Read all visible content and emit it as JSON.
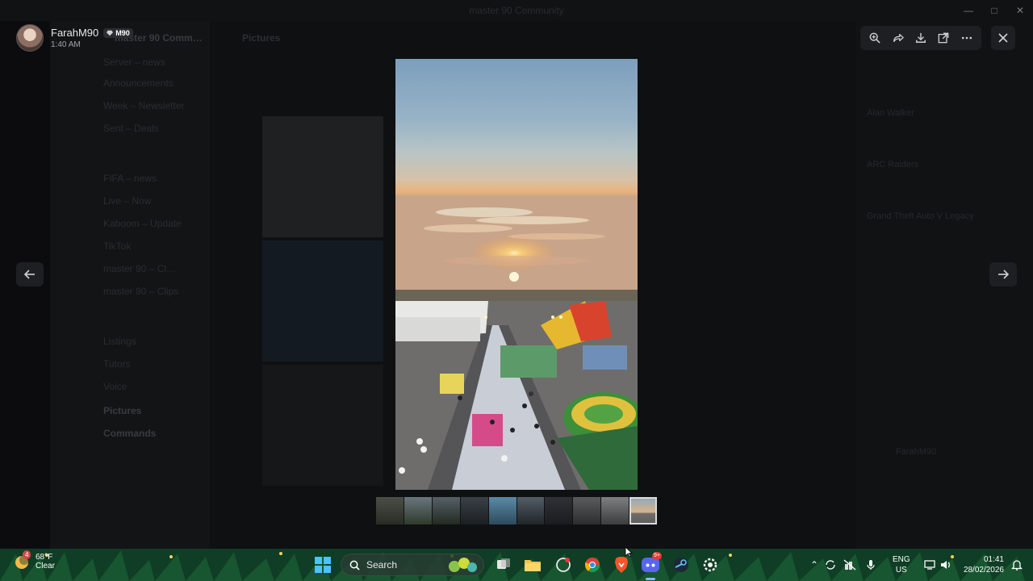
{
  "window": {
    "title": "master 90 Community"
  },
  "background": {
    "server_name": "master 90 Comm…",
    "channel_header": "Pictures",
    "channels": [
      "Server – news",
      "Announcements",
      "Week – Newsletter",
      "Sent – Deals",
      "FIFA – news",
      "Live – Now",
      "Kaboom – Update",
      "TikTok",
      "master 90 – Cl…",
      "master 90 – Clips",
      "Listings",
      "Tutors",
      "Voice",
      "Pictures",
      "Commands"
    ],
    "members": [
      "Alan Walker",
      "ARC Raiders",
      "Grand Theft Auto V Legacy",
      "FarahM90"
    ]
  },
  "viewer": {
    "uploader_name": "FarahM90",
    "uploader_badge": "M90",
    "uploader_time": "1:40 AM",
    "thumbnail_count": 10,
    "active_thumbnail_index": 9
  },
  "icons": {
    "zoom": "zoom-in-icon",
    "forward": "forward-icon",
    "download": "download-icon",
    "open": "open-external-icon",
    "more": "more-icon",
    "close": "close-icon",
    "prev": "arrow-left-icon",
    "next": "arrow-right-icon"
  },
  "taskbar": {
    "weather_temp": "68°F",
    "weather_cond": "Clear",
    "weather_alert": "4",
    "search_label": "Search",
    "discord_badge": "9+",
    "lang_line1": "ENG",
    "lang_line2": "US",
    "time": "01:41",
    "date": "28/02/2026"
  },
  "colors": {
    "overlay": "#000000",
    "button_bg": "#1e1f22",
    "taskbar": "#0d3a22"
  }
}
